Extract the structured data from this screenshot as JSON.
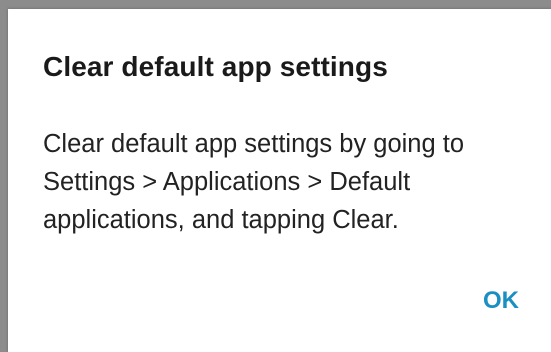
{
  "dialog": {
    "title": "Clear default app settings",
    "message": "Clear default app settings by going to Settings > Applications > Default applications, and tapping Clear.",
    "ok_label": "OK"
  },
  "colors": {
    "accent": "#1a8fc1",
    "dialog_background": "#ffffff",
    "scrim": "#8c8c8c"
  }
}
